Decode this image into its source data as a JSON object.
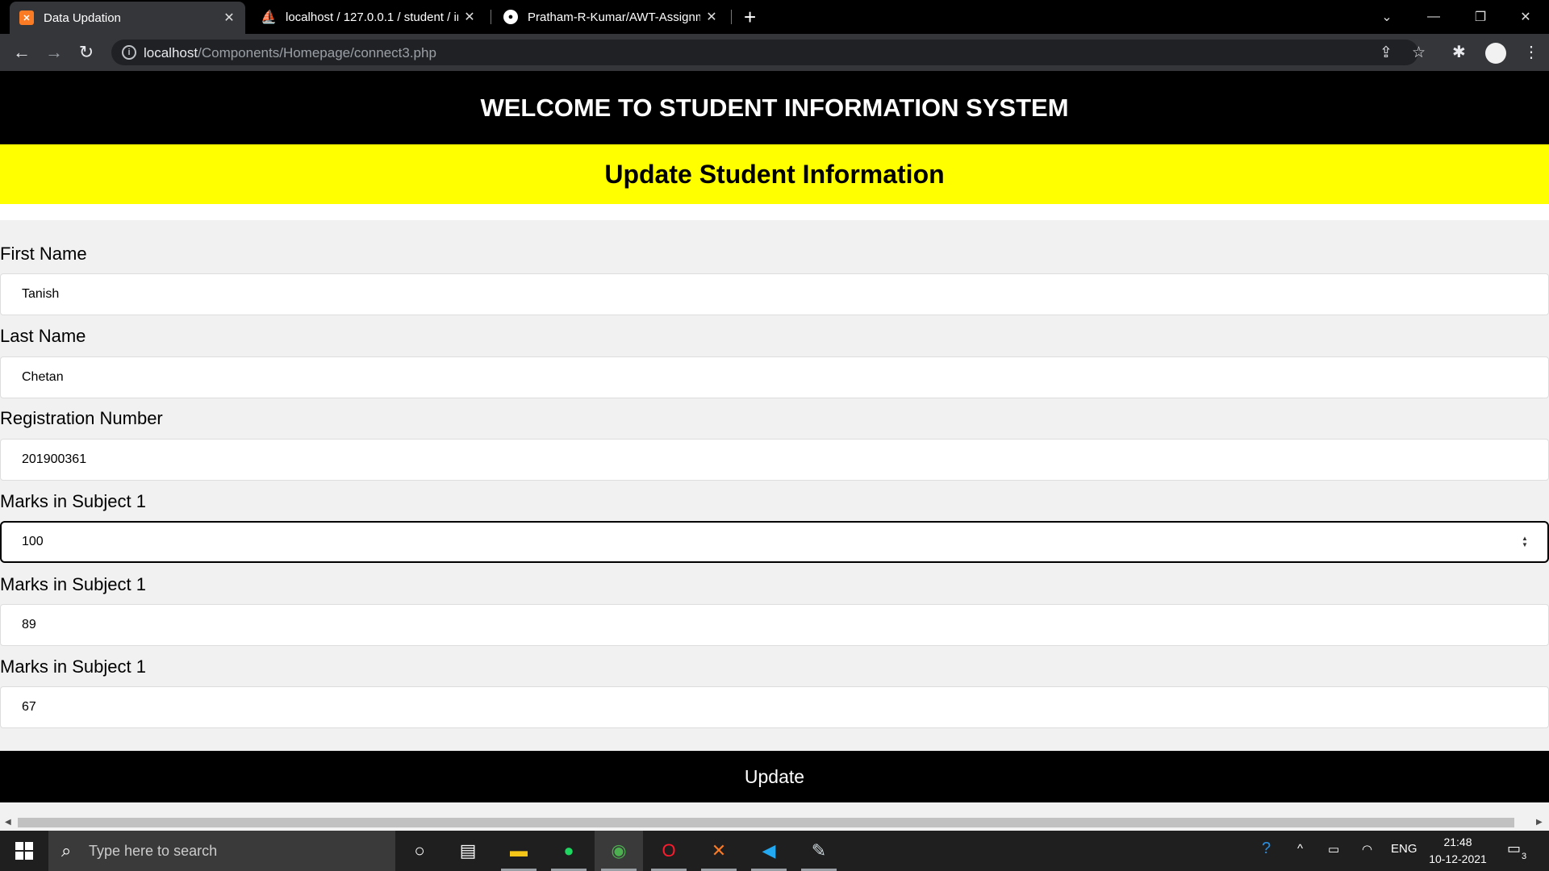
{
  "browser": {
    "tabs": [
      {
        "title": "Data Updation"
      },
      {
        "title": "localhost / 127.0.0.1 / student / ir"
      },
      {
        "title": "Pratham-R-Kumar/AWT-Assignm"
      }
    ],
    "url_host": "localhost",
    "url_path": "/Components/Homepage/connect3.php"
  },
  "page": {
    "header": "WELCOME TO STUDENT INFORMATION SYSTEM",
    "subheader": "Update Student Information",
    "fields": [
      {
        "label": "First Name",
        "value": "Tanish"
      },
      {
        "label": "Last Name",
        "value": "Chetan"
      },
      {
        "label": "Registration Number",
        "value": "201900361"
      },
      {
        "label": "Marks in Subject 1",
        "value": "100"
      },
      {
        "label": "Marks in Subject 1",
        "value": "89"
      },
      {
        "label": "Marks in Subject 1",
        "value": "67"
      }
    ],
    "submit_label": "Update"
  },
  "taskbar": {
    "search_placeholder": "Type here to search",
    "language": "ENG",
    "time": "21:48",
    "date": "10-12-2021",
    "notification_count": "3"
  },
  "colors": {
    "header_bg": "#000000",
    "subheader_bg": "#ffff00",
    "button_bg": "#000000"
  }
}
